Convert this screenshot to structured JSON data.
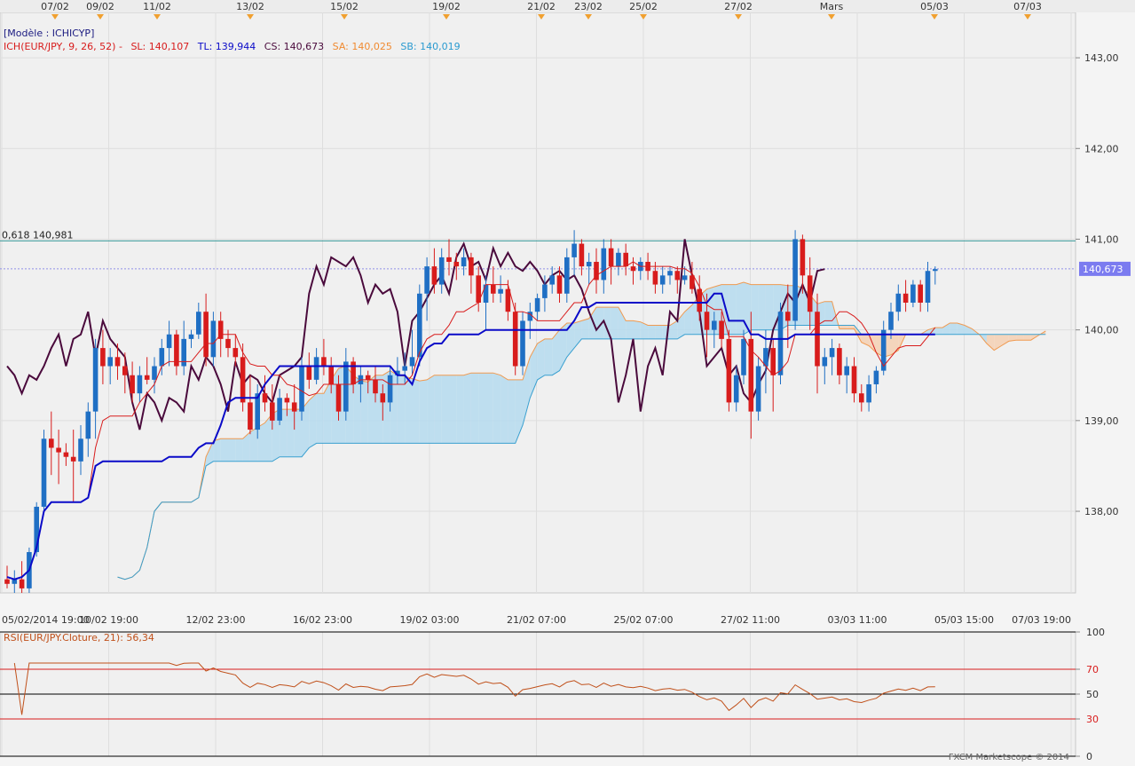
{
  "legend": {
    "model": "[Modèle : ICHICYP]",
    "indicator": "ICH(EUR/JPY, 9, 26, 52) -",
    "sl": "SL: 140,107",
    "tl": "TL: 139,944",
    "cs": "CS: 140,673",
    "sa": "SA: 140,025",
    "sb": "SB: 140,019"
  },
  "colors": {
    "up": "#1f6fc4",
    "down": "#d81c1c",
    "tenkan": "#d81c1c",
    "kijun": "#0a0ac8",
    "chikou": "#4a0a3c",
    "senkou_a": "#f09a50",
    "senkou_b": "#3aa0d0",
    "kumo_bull": "#b8dcee",
    "kumo_bear": "#f4d2b6",
    "fib": "#3a9a9a",
    "price_badge": "#7b7bf0",
    "rsi": "#c0501a",
    "rsi_level": "#d81c1c"
  },
  "fib_label": "0,618 140,981",
  "current_price_label": "140,673",
  "top_dates": [
    "07/02",
    "09/02",
    "11/02",
    "13/02",
    "15/02",
    "19/02",
    "21/02",
    "23/02",
    "25/02",
    "27/02",
    "Mars",
    "05/03",
    "07/03"
  ],
  "bottom_dates": [
    "05/02/2014 19:00",
    "10/02 19:00",
    "12/02 23:00",
    "16/02 23:00",
    "19/02 03:00",
    "21/02 07:00",
    "25/02 07:00",
    "27/02 11:00",
    "03/03 11:00",
    "05/03 15:00",
    "07/03 19:00"
  ],
  "price_ticks": [
    "143,00",
    "142,00",
    "141,00",
    "140,00",
    "139,00",
    "138,00"
  ],
  "rsi_title": "RSI(EUR/JPY.Cloture, 21): 56,34",
  "rsi_ticks": [
    "100",
    "70",
    "50",
    "30",
    "0"
  ],
  "footer": "FXCM Marketscope © 2014",
  "chart_data": {
    "type": "candlestick",
    "symbol": "EUR/JPY",
    "ylim": [
      137.1,
      143.5
    ],
    "fib_level": 140.981,
    "current_price": 140.673,
    "candles_ohlc": [
      [
        137.25,
        137.4,
        137.15,
        137.2
      ],
      [
        137.2,
        137.35,
        137.1,
        137.25
      ],
      [
        137.25,
        137.45,
        137.1,
        137.15
      ],
      [
        137.15,
        137.6,
        137.1,
        137.55
      ],
      [
        137.55,
        138.1,
        137.5,
        138.05
      ],
      [
        138.05,
        138.9,
        138.0,
        138.8
      ],
      [
        138.8,
        139.1,
        138.4,
        138.7
      ],
      [
        138.7,
        138.9,
        138.3,
        138.65
      ],
      [
        138.65,
        138.75,
        138.5,
        138.6
      ],
      [
        138.6,
        138.9,
        138.1,
        138.55
      ],
      [
        138.55,
        138.95,
        138.4,
        138.8
      ],
      [
        138.8,
        139.2,
        138.6,
        139.1
      ],
      [
        139.1,
        139.9,
        138.8,
        139.8
      ],
      [
        139.8,
        140.0,
        139.4,
        139.6
      ],
      [
        139.6,
        139.8,
        139.4,
        139.7
      ],
      [
        139.7,
        139.85,
        139.45,
        139.6
      ],
      [
        139.6,
        139.75,
        139.3,
        139.5
      ],
      [
        139.5,
        139.65,
        139.2,
        139.3
      ],
      [
        139.3,
        139.6,
        139.2,
        139.5
      ],
      [
        139.5,
        139.7,
        139.4,
        139.45
      ],
      [
        139.45,
        139.7,
        139.3,
        139.6
      ],
      [
        139.6,
        139.9,
        139.5,
        139.8
      ],
      [
        139.8,
        140.1,
        139.6,
        139.95
      ],
      [
        139.95,
        140.0,
        139.5,
        139.6
      ],
      [
        139.6,
        140.1,
        139.5,
        139.9
      ],
      [
        139.9,
        140.0,
        139.8,
        139.95
      ],
      [
        139.95,
        140.3,
        139.9,
        140.2
      ],
      [
        140.2,
        140.4,
        139.6,
        139.7
      ],
      [
        139.7,
        140.2,
        139.6,
        140.1
      ],
      [
        140.1,
        140.2,
        139.7,
        139.9
      ],
      [
        139.9,
        140.0,
        139.7,
        139.8
      ],
      [
        139.8,
        139.95,
        139.6,
        139.7
      ],
      [
        139.7,
        139.85,
        139.1,
        139.2
      ],
      [
        139.2,
        139.5,
        138.85,
        138.9
      ],
      [
        138.9,
        139.4,
        138.8,
        139.3
      ],
      [
        139.3,
        139.5,
        139.1,
        139.2
      ],
      [
        139.2,
        139.4,
        138.9,
        139.0
      ],
      [
        139.0,
        139.35,
        138.95,
        139.25
      ],
      [
        139.25,
        139.3,
        139.05,
        139.2
      ],
      [
        139.2,
        139.4,
        138.9,
        139.1
      ],
      [
        139.1,
        139.7,
        139.0,
        139.6
      ],
      [
        139.6,
        139.75,
        139.35,
        139.45
      ],
      [
        139.45,
        139.8,
        139.4,
        139.7
      ],
      [
        139.7,
        139.9,
        139.5,
        139.6
      ],
      [
        139.6,
        139.7,
        139.3,
        139.4
      ],
      [
        139.4,
        139.5,
        139.0,
        139.1
      ],
      [
        139.1,
        139.8,
        139.0,
        139.65
      ],
      [
        139.65,
        139.7,
        139.3,
        139.4
      ],
      [
        139.4,
        139.6,
        139.2,
        139.5
      ],
      [
        139.5,
        139.55,
        139.3,
        139.45
      ],
      [
        139.45,
        139.6,
        139.2,
        139.3
      ],
      [
        139.3,
        139.4,
        139.0,
        139.2
      ],
      [
        139.2,
        139.6,
        139.1,
        139.5
      ],
      [
        139.5,
        139.7,
        139.4,
        139.55
      ],
      [
        139.55,
        139.75,
        139.4,
        139.6
      ],
      [
        139.6,
        140.0,
        139.5,
        139.7
      ],
      [
        139.7,
        140.5,
        139.6,
        140.4
      ],
      [
        140.4,
        140.8,
        140.1,
        140.7
      ],
      [
        140.7,
        140.9,
        140.4,
        140.5
      ],
      [
        140.5,
        140.9,
        140.4,
        140.8
      ],
      [
        140.8,
        141.0,
        140.6,
        140.75
      ],
      [
        140.75,
        140.85,
        140.55,
        140.7
      ],
      [
        140.7,
        140.9,
        140.6,
        140.8
      ],
      [
        140.8,
        140.85,
        140.4,
        140.6
      ],
      [
        140.6,
        140.7,
        140.2,
        140.3
      ],
      [
        140.3,
        140.6,
        140.0,
        140.5
      ],
      [
        140.5,
        140.7,
        140.3,
        140.4
      ],
      [
        140.4,
        140.6,
        140.3,
        140.45
      ],
      [
        140.45,
        140.55,
        140.1,
        140.2
      ],
      [
        140.2,
        140.3,
        139.5,
        139.6
      ],
      [
        139.6,
        140.2,
        139.5,
        140.1
      ],
      [
        140.1,
        140.3,
        139.9,
        140.2
      ],
      [
        140.2,
        140.4,
        140.1,
        140.35
      ],
      [
        140.35,
        140.6,
        140.2,
        140.5
      ],
      [
        140.5,
        140.7,
        140.4,
        140.6
      ],
      [
        140.6,
        140.7,
        140.3,
        140.4
      ],
      [
        140.4,
        140.9,
        140.3,
        140.8
      ],
      [
        140.8,
        141.1,
        140.6,
        140.95
      ],
      [
        140.95,
        141.0,
        140.6,
        140.7
      ],
      [
        140.7,
        140.85,
        140.5,
        140.75
      ],
      [
        140.75,
        140.9,
        140.4,
        140.55
      ],
      [
        140.55,
        141.0,
        140.4,
        140.9
      ],
      [
        140.9,
        141.0,
        140.5,
        140.7
      ],
      [
        140.7,
        140.9,
        140.6,
        140.85
      ],
      [
        140.85,
        140.95,
        140.6,
        140.7
      ],
      [
        140.7,
        140.8,
        140.5,
        140.65
      ],
      [
        140.65,
        140.8,
        140.55,
        140.75
      ],
      [
        140.75,
        140.85,
        140.55,
        140.65
      ],
      [
        140.65,
        140.75,
        140.4,
        140.5
      ],
      [
        140.5,
        140.7,
        140.4,
        140.6
      ],
      [
        140.6,
        140.7,
        140.5,
        140.65
      ],
      [
        140.65,
        140.7,
        140.4,
        140.55
      ],
      [
        140.55,
        140.7,
        140.5,
        140.6
      ],
      [
        140.6,
        140.75,
        140.4,
        140.45
      ],
      [
        140.45,
        140.6,
        140.1,
        140.2
      ],
      [
        140.2,
        140.4,
        139.7,
        140.0
      ],
      [
        140.0,
        140.2,
        139.8,
        140.1
      ],
      [
        140.1,
        140.2,
        139.8,
        139.9
      ],
      [
        139.9,
        140.0,
        139.1,
        139.2
      ],
      [
        139.2,
        139.6,
        139.1,
        139.5
      ],
      [
        139.5,
        140.0,
        139.4,
        139.9
      ],
      [
        139.9,
        140.2,
        138.8,
        139.1
      ],
      [
        139.1,
        139.7,
        139.0,
        139.6
      ],
      [
        139.6,
        140.0,
        139.3,
        139.8
      ],
      [
        139.8,
        139.9,
        139.1,
        139.5
      ],
      [
        139.5,
        140.3,
        139.4,
        140.2
      ],
      [
        140.2,
        140.5,
        139.8,
        140.1
      ],
      [
        140.1,
        141.1,
        140.0,
        141.0
      ],
      [
        141.0,
        141.05,
        140.4,
        140.6
      ],
      [
        140.6,
        140.8,
        140.0,
        140.2
      ],
      [
        140.2,
        140.4,
        139.3,
        139.6
      ],
      [
        139.6,
        139.8,
        139.4,
        139.7
      ],
      [
        139.7,
        139.9,
        139.5,
        139.8
      ],
      [
        139.8,
        139.85,
        139.4,
        139.5
      ],
      [
        139.5,
        139.7,
        139.3,
        139.6
      ],
      [
        139.6,
        139.7,
        139.2,
        139.3
      ],
      [
        139.3,
        139.4,
        139.1,
        139.2
      ],
      [
        139.2,
        139.5,
        139.1,
        139.4
      ],
      [
        139.4,
        139.6,
        139.3,
        139.55
      ],
      [
        139.55,
        140.1,
        139.5,
        140.0
      ],
      [
        140.0,
        140.3,
        139.9,
        140.2
      ],
      [
        140.2,
        140.5,
        140.1,
        140.4
      ],
      [
        140.4,
        140.55,
        140.2,
        140.3
      ],
      [
        140.3,
        140.55,
        140.25,
        140.5
      ],
      [
        140.5,
        140.55,
        140.2,
        140.3
      ],
      [
        140.3,
        140.75,
        140.2,
        140.65
      ],
      [
        140.65,
        140.7,
        140.5,
        140.67
      ]
    ],
    "rsi": {
      "period": 21,
      "last": 56.34,
      "levels": [
        70,
        50,
        30
      ],
      "ylim": [
        0,
        100
      ]
    }
  }
}
